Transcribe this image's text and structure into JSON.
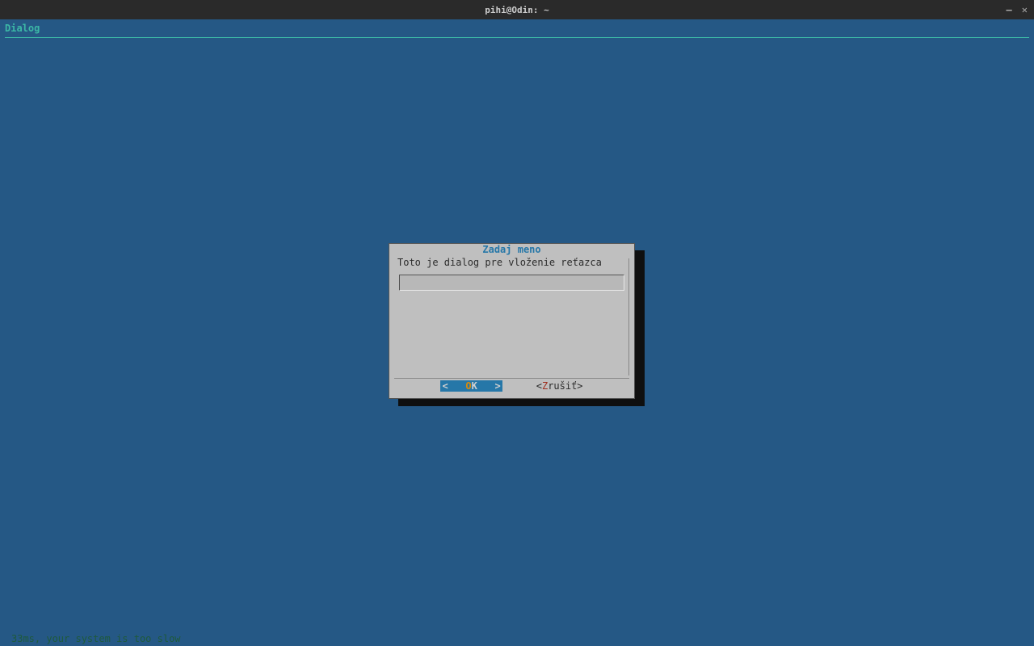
{
  "window": {
    "title": "pihi@Odin: ~"
  },
  "terminal": {
    "header": "Dialog"
  },
  "dialog": {
    "title": "Zadaj meno",
    "prompt": "Toto je dialog pre vloženie reťazca",
    "input_value": "",
    "buttons": {
      "ok": {
        "prefix": "<   ",
        "hotkey": "O",
        "rest": "K   >"
      },
      "cancel": {
        "prefix": "<",
        "hotkey": "Z",
        "rest": "rušiť>"
      }
    }
  },
  "status": {
    "message": "33ms, your system is too slow"
  }
}
